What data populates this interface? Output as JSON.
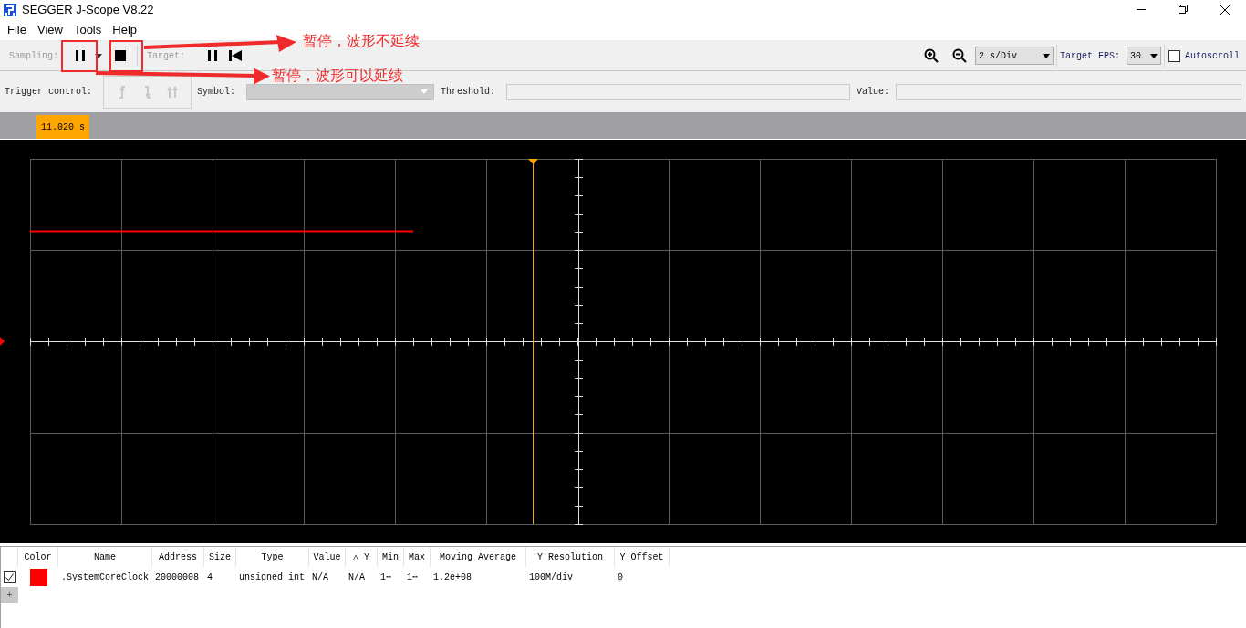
{
  "window": {
    "title": "SEGGER J-Scope V8.22"
  },
  "menu": [
    "File",
    "View",
    "Tools",
    "Help"
  ],
  "toolbar": {
    "sampling_label": "Sampling:",
    "target_label": "Target:",
    "time_scale": "2 s/Div",
    "fps_label": "Target FPS:",
    "fps": "30",
    "autoscroll": {
      "label": "Autoscroll",
      "checked": false
    }
  },
  "trigger": {
    "label": "Trigger control:",
    "symbol_label": "Symbol:",
    "threshold_label": "Threshold:",
    "value_label": "Value:"
  },
  "time_marker": "11.020 s",
  "table": {
    "columns": [
      "Color",
      "Name",
      "Address",
      "Size",
      "Type",
      "Value",
      "△ Y",
      "Min",
      "Max",
      "Moving Average",
      "Y Resolution",
      "Y Offset"
    ],
    "rows": [
      {
        "checked": true,
        "color": "#ff0000",
        "cells": [
          "",
          ".SystemCoreClock",
          "20000008",
          "4",
          "unsigned int",
          "N/A",
          "N/A",
          "1⋯",
          "1⋯",
          "1.2e+08",
          "100M/div",
          "0"
        ]
      }
    ],
    "add_row": "+"
  },
  "annotations": [
    {
      "text": "暂停，波形不延续"
    },
    {
      "text": "暂停，波形可以延续"
    }
  ]
}
